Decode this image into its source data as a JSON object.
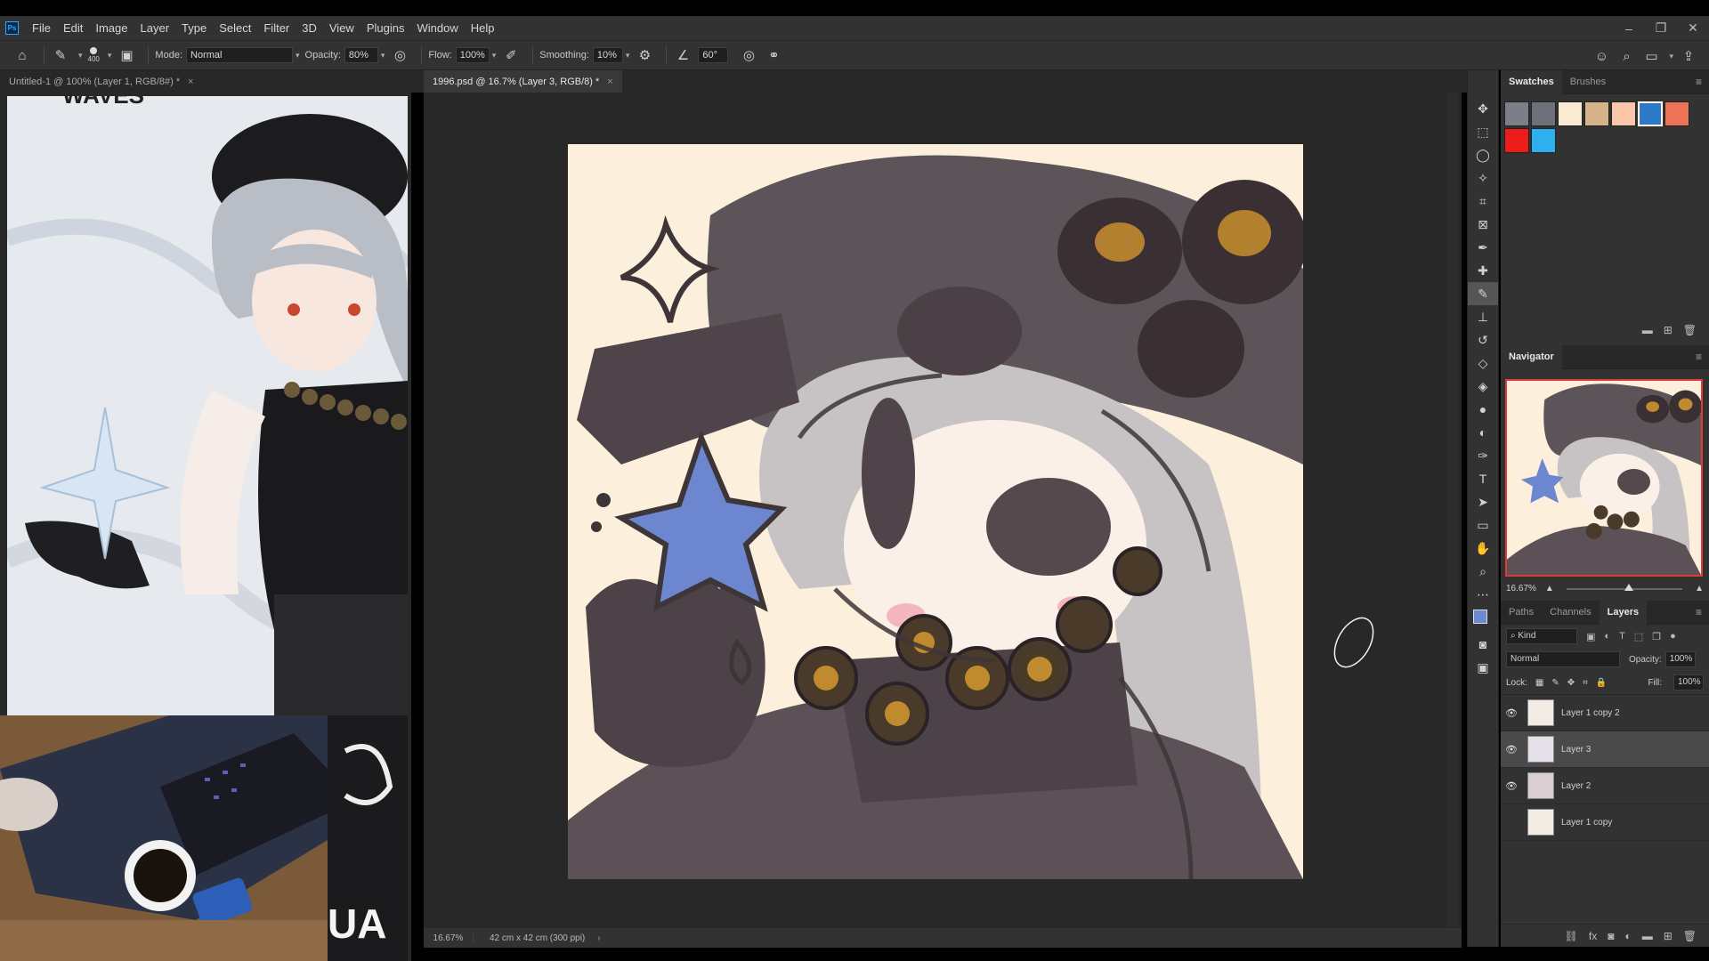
{
  "app": {
    "logo": "Ps"
  },
  "menu": [
    "File",
    "Edit",
    "Image",
    "Layer",
    "Type",
    "Select",
    "Filter",
    "3D",
    "View",
    "Plugins",
    "Window",
    "Help"
  ],
  "window_controls": {
    "minimize": "–",
    "restore": "❐",
    "close": "✕"
  },
  "options": {
    "brush_size": "400",
    "mode_label": "Mode:",
    "mode_value": "Normal",
    "opacity_label": "Opacity:",
    "opacity_value": "80%",
    "flow_label": "Flow:",
    "flow_value": "100%",
    "smoothing_label": "Smoothing:",
    "smoothing_value": "10%",
    "angle_value": "60°"
  },
  "tabs": [
    {
      "label": "Untitled-1 @ 100% (Layer 1, RGB/8#) *",
      "close": "×"
    },
    {
      "label": "1996.psd @ 16.7% (Layer 3, RGB/8) *",
      "close": "×"
    }
  ],
  "reference": {
    "top_text": "WAVES",
    "bottom_text": "UA"
  },
  "status": {
    "zoom": "16.67%",
    "dims": "42 cm x 42 cm (300 ppi)",
    "arrow": "›"
  },
  "panels": {
    "swatches_tab": "Swatches",
    "brushes_tab": "Brushes",
    "swatch_colors": [
      "#7b7f89",
      "#6e717a",
      "#fbead3",
      "#d7b28b",
      "#f7c7a8",
      "#2e78c8",
      "#ec7356",
      "#ee1c19",
      "#2eaff0"
    ],
    "navigator_tab": "Navigator",
    "nav_zoom": "16.67%",
    "paths_tab": "Paths",
    "channels_tab": "Channels",
    "layers_tab": "Layers",
    "kind_label": "Kind",
    "blend_mode": "Normal",
    "opacity_label": "Opacity:",
    "opacity_value": "100%",
    "lock_label": "Lock:",
    "fill_label": "Fill:",
    "fill_value": "100%",
    "layers": [
      {
        "name": "Layer 1 copy 2",
        "visible": true
      },
      {
        "name": "Layer 3",
        "visible": true
      },
      {
        "name": "Layer 2",
        "visible": true
      },
      {
        "name": "Layer 1 copy",
        "visible": false
      }
    ]
  }
}
